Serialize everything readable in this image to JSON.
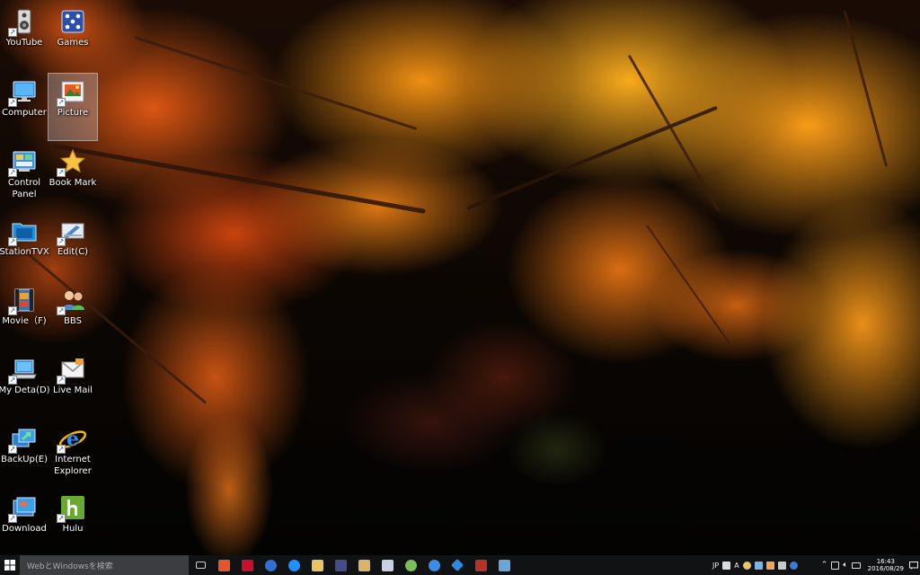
{
  "desktop": {
    "icons": [
      {
        "id": "youtube",
        "label": "YouTube",
        "icon": "speaker-icon"
      },
      {
        "id": "games",
        "label": "Games",
        "icon": "dice-icon"
      },
      {
        "id": "computer",
        "label": "Computer",
        "icon": "monitor-icon"
      },
      {
        "id": "picture",
        "label": "Picture",
        "icon": "picture-icon",
        "selected": true
      },
      {
        "id": "control-panel",
        "label": "Control Panel",
        "icon": "control-panel-icon"
      },
      {
        "id": "book-mark",
        "label": "Book Mark",
        "icon": "star-icon"
      },
      {
        "id": "stationtvx",
        "label": "StationTVX",
        "icon": "tv-folder-icon"
      },
      {
        "id": "edit",
        "label": "Edit(C)",
        "icon": "edit-drive-icon"
      },
      {
        "id": "movie",
        "label": "Movie（F)",
        "icon": "film-icon"
      },
      {
        "id": "bbs",
        "label": "BBS",
        "icon": "people-icon"
      },
      {
        "id": "my-deta",
        "label": "My Deta(D)",
        "icon": "laptop-icon"
      },
      {
        "id": "live-mail",
        "label": "Live Mail",
        "icon": "mail-icon"
      },
      {
        "id": "backup",
        "label": "BackUp(E)",
        "icon": "backup-icon"
      },
      {
        "id": "internet-explorer",
        "label": "Internet Explorer",
        "icon": "ie-icon"
      },
      {
        "id": "download",
        "label": "Download",
        "icon": "download-icon"
      },
      {
        "id": "hulu",
        "label": "Hulu",
        "icon": "hulu-icon"
      }
    ]
  },
  "taskbar": {
    "search_placeholder": "WebとWindowsを検索",
    "pinned": [
      {
        "name": "task-view-button",
        "icon": "task-view-icon",
        "color": "#cfcfcf"
      },
      {
        "name": "power-app-button",
        "icon": "power-icon",
        "color": "#e5562a"
      },
      {
        "name": "mcafee-button",
        "icon": "m-shield-icon",
        "color": "#c8102e"
      },
      {
        "name": "browser-globe-button",
        "icon": "globe-icon",
        "color": "#2f6fd6"
      },
      {
        "name": "edge-button",
        "icon": "edge-icon",
        "color": "#1e90ff"
      },
      {
        "name": "file-explorer-button",
        "icon": "folder-icon",
        "color": "#e8c560"
      },
      {
        "name": "media-player-button",
        "icon": "play-icon",
        "color": "#444c8a"
      },
      {
        "name": "photos-button",
        "icon": "photo-icon",
        "color": "#d9b46a"
      },
      {
        "name": "paint-button",
        "icon": "paint-icon",
        "color": "#c9d2dc"
      },
      {
        "name": "settings-app-button",
        "icon": "sync-icon",
        "color": "#7bbf5a"
      },
      {
        "name": "safari-button",
        "icon": "compass-icon",
        "color": "#3a8ee6"
      },
      {
        "name": "app-diamond-button",
        "icon": "diamond-icon",
        "color": "#2a8de0"
      },
      {
        "name": "app-red-button",
        "icon": "red-square-icon",
        "color": "#b43226"
      },
      {
        "name": "app-image-button",
        "icon": "image-icon",
        "color": "#6aa4d8"
      }
    ],
    "tray": {
      "ime_label": "JP",
      "ime_mode": "A",
      "clock_time": "16:43",
      "clock_date": "2016/08/29"
    }
  }
}
